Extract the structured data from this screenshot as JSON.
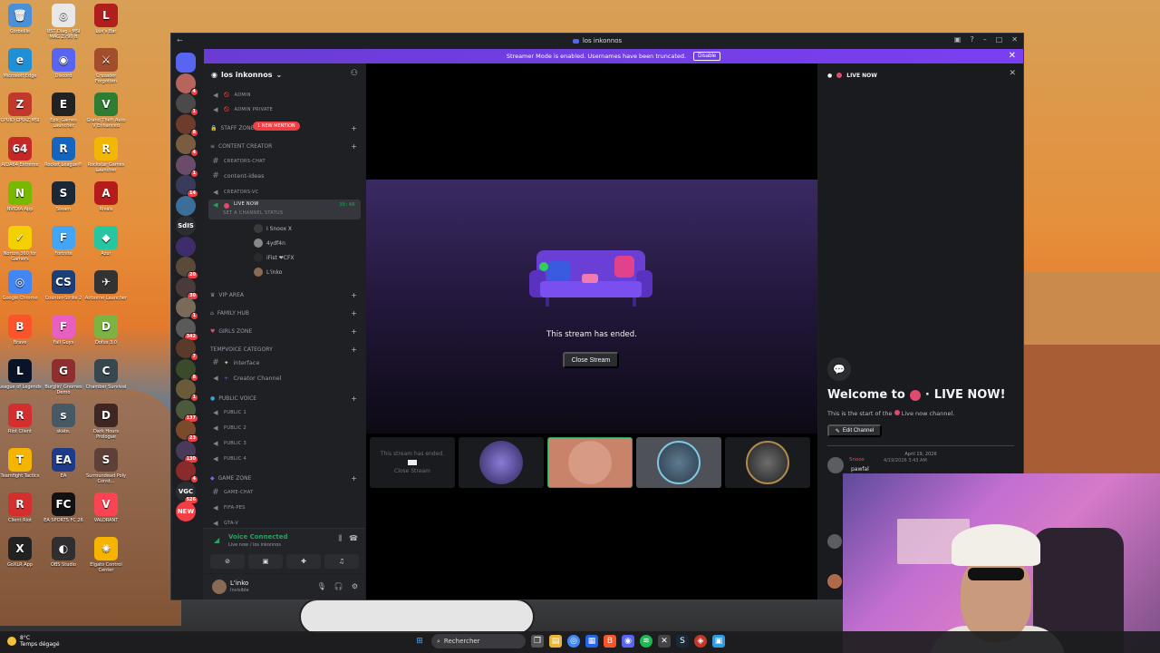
{
  "desktop": {
    "icons": [
      {
        "label": "Corbeille",
        "color": "#4a90d9",
        "glyph": "🗑"
      },
      {
        "label": "UST Diag - MSI MAG Z790 B",
        "color": "#e8e8e8",
        "glyph": "◎"
      },
      {
        "label": "Lux's Bar",
        "color": "#b11e1e",
        "glyph": "L"
      },
      {
        "label": "Microsoft Edge",
        "color": "#1f8fd6",
        "glyph": "e"
      },
      {
        "label": "Discord",
        "color": "#5865f2",
        "glyph": "◉"
      },
      {
        "label": "Crusader Forgotten",
        "color": "#a24d2b",
        "glyph": "⚔"
      },
      {
        "label": "CPUID CPU-Z MSI",
        "color": "#c0392b",
        "glyph": "Z"
      },
      {
        "label": "Epic Games Launcher",
        "color": "#222222",
        "glyph": "E"
      },
      {
        "label": "Grand Theft Auto V Enhanced",
        "color": "#2e7d32",
        "glyph": "V"
      },
      {
        "label": "AIDA64 Extreme",
        "color": "#c62828",
        "glyph": "64"
      },
      {
        "label": "Rocket League®",
        "color": "#1565c0",
        "glyph": "R"
      },
      {
        "label": "Rockstar Games Launcher",
        "color": "#f2b705",
        "glyph": "R"
      },
      {
        "label": "NVIDIA App",
        "color": "#76b900",
        "glyph": "N"
      },
      {
        "label": "Steam",
        "color": "#1b2838",
        "glyph": "S"
      },
      {
        "label": "Rivals",
        "color": "#b71c1c",
        "glyph": "A"
      },
      {
        "label": "Norton 360 for Gamers",
        "color": "#f5d000",
        "glyph": "✓"
      },
      {
        "label": "Fortnite",
        "color": "#42a5f5",
        "glyph": "F"
      },
      {
        "label": "Azur",
        "color": "#26c6a0",
        "glyph": "◆"
      },
      {
        "label": "Google Chrome",
        "color": "#4285f4",
        "glyph": "◎"
      },
      {
        "label": "Counter-Strike 2",
        "color": "#1c3f7a",
        "glyph": "CS"
      },
      {
        "label": "Airborne Launcher",
        "color": "#333333",
        "glyph": "✈"
      },
      {
        "label": "Brave",
        "color": "#fb542b",
        "glyph": "B"
      },
      {
        "label": "Fall Guys",
        "color": "#e85fc1",
        "glyph": "F"
      },
      {
        "label": "Dofus 3.0",
        "color": "#7cb342",
        "glyph": "D"
      },
      {
        "label": "League of Legends",
        "color": "#0a1428",
        "glyph": "L"
      },
      {
        "label": "Burglin' Gnomes Demo",
        "color": "#8e2e2e",
        "glyph": "G"
      },
      {
        "label": "Chamber Survival",
        "color": "#37474f",
        "glyph": "C"
      },
      {
        "label": "Riot Client",
        "color": "#d32f2f",
        "glyph": "R"
      },
      {
        "label": "skate.",
        "color": "#455a64",
        "glyph": "s"
      },
      {
        "label": "Dark Hours Prologue",
        "color": "#3e2723",
        "glyph": "D"
      },
      {
        "label": "Teamfight Tactics",
        "color": "#f4b400",
        "glyph": "T"
      },
      {
        "label": "EA",
        "color": "#1e3a8a",
        "glyph": "EA"
      },
      {
        "label": "Surroundead Poly Const...",
        "color": "#5d4037",
        "glyph": "S"
      },
      {
        "label": "Client Riot",
        "color": "#d32f2f",
        "glyph": "R"
      },
      {
        "label": "EA SPORTS FC 26",
        "color": "#111111",
        "glyph": "FC"
      },
      {
        "label": "VALORANT",
        "color": "#fa4454",
        "glyph": "V"
      },
      {
        "label": "GoXLR App",
        "color": "#222222",
        "glyph": "X"
      },
      {
        "label": "OBS Studio",
        "color": "#302e31",
        "glyph": "◐"
      },
      {
        "label": "Elgato Control Center",
        "color": "#f6b400",
        "glyph": "✺"
      }
    ]
  },
  "taskbar": {
    "weather_temp": "8°C",
    "weather_desc": "Temps dégagé",
    "search_placeholder": "Rechercher"
  },
  "window": {
    "title": "los inkonnos"
  },
  "banner": {
    "text": "Streamer Mode is enabled. Usernames have been truncated.",
    "disable_label": "Disable"
  },
  "rail": {
    "servers": [
      {
        "color": "#5865f2",
        "badge": ""
      },
      {
        "color": "#b5655c",
        "badge": "4"
      },
      {
        "color": "#4a4a4a",
        "badge": "1"
      },
      {
        "color": "#6d3c2a",
        "badge": "8"
      },
      {
        "color": "#7a5c3e",
        "badge": "4"
      },
      {
        "color": "#6b4a6a",
        "badge": "1"
      },
      {
        "color": "#3a3a5a",
        "badge": "14"
      },
      {
        "color": "#3c6e9a",
        "badge": ""
      },
      {
        "color": "#2b2d31",
        "badge": "",
        "text": "SdIS"
      },
      {
        "color": "#3d2d6b",
        "badge": ""
      },
      {
        "color": "#5a4a3a",
        "badge": "20"
      },
      {
        "color": "#4a3a3a",
        "badge": "30"
      },
      {
        "color": "#7a6a5a",
        "badge": "1"
      },
      {
        "color": "#5a5a5a",
        "badge": "342"
      },
      {
        "color": "#5a3a2a",
        "badge": "7"
      },
      {
        "color": "#3a4a2a",
        "badge": "8"
      },
      {
        "color": "#6a5a3a",
        "badge": "1"
      },
      {
        "color": "#4a5a3a",
        "badge": "137"
      },
      {
        "color": "#7a4a2a",
        "badge": "23"
      },
      {
        "color": "#4a3a5a",
        "badge": "130"
      },
      {
        "color": "#8a2a2a",
        "badge": "4"
      },
      {
        "color": "#2b2d31",
        "badge": "526",
        "text": "VGC"
      },
      {
        "color": "#f23f43",
        "badge": "",
        "text": "NEW"
      }
    ]
  },
  "sidebar": {
    "server_name": "los inkonnos",
    "mention_pill": "1 NEW MENTION",
    "admin_label": "ADMIN",
    "admin_private": "ADMIN PRIVATE",
    "staff_zone": "STAFF ZONE",
    "content_creator": "CONTENT CREATOR",
    "creators_chat": "CREATORS-CHAT",
    "content_ideas": "content-ideas",
    "creators_vc": "CREATORS-VC",
    "live_now": "LIVE NOW",
    "live_timer": "30:46",
    "live_status": "Set a channel status",
    "members": [
      "I Snoox X",
      "4ydf4n",
      "iFist ❤CFX",
      "L'inko"
    ],
    "vip_area": "VIP AREA",
    "family_hub": "FAMILY HUB",
    "girls_zone": "GIRLS ZONE",
    "tempvoice": "TEMPVOICE CATEGORY",
    "interface": "interface",
    "creator_channel": "Creator Channel",
    "public_voice": "PUBLIC VOICE",
    "public_channels": [
      "PUBLIC 1",
      "PUBLIC 2",
      "PUBLIC 3",
      "PUBLIC 4"
    ],
    "game_zone": "GAME ZONE",
    "game_chat": "GAME-CHAT",
    "fifa_pes": "FIFA-PES",
    "gta_v": "GTA-V"
  },
  "voice": {
    "connected_label": "Voice Connected",
    "channel_path": "Live now / los inkonnos"
  },
  "user": {
    "name": "L'inko",
    "status": "Invisible"
  },
  "stage": {
    "ended_text": "This stream has ended.",
    "close_label": "Close Stream",
    "mini_ended": "This stream has ended.",
    "mini_close": "Close Stream"
  },
  "chat": {
    "header": "LIVE NOW",
    "welcome_prefix": "Welcome to",
    "welcome_channel": "LIVE NOW!",
    "start_text": "This is the start of the",
    "start_channel": "Live now",
    "start_suffix": "channel.",
    "edit_label": "Edit Channel",
    "date": "April 19, 2026",
    "msg_author": "Snoox",
    "msg_time": "4/19/2026 3:43 AM",
    "msg_text": "pawfal"
  },
  "colors": {
    "accent": "#5865f2",
    "banner": "#7b3ff2",
    "online": "#23a55a",
    "danger": "#f23f43",
    "live_dot": "#e04a6e"
  }
}
